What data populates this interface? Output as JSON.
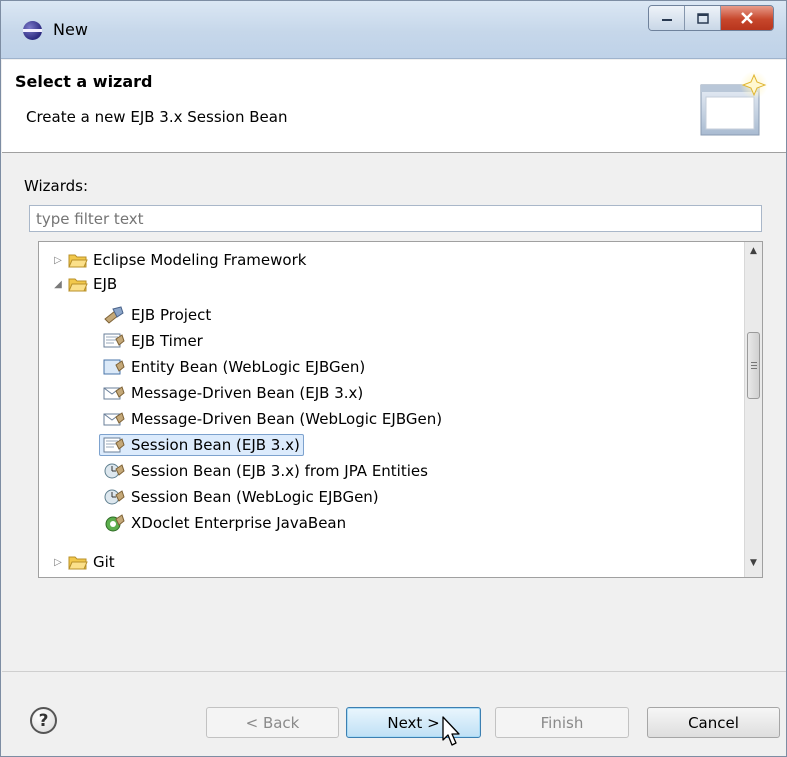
{
  "window": {
    "title": "New"
  },
  "header": {
    "title": "Select a wizard",
    "description": "Create a new EJB 3.x Session Bean"
  },
  "wizards_label": "Wizards:",
  "filter": {
    "value": "",
    "placeholder": "type filter text"
  },
  "tree": {
    "rows": [
      {
        "label": "Eclipse Modeling Framework",
        "type": "folder",
        "expanded": false
      },
      {
        "label": "EJB",
        "type": "folder",
        "expanded": true
      },
      {
        "label": "EJB Project",
        "type": "item",
        "icon": "ejb-project-icon"
      },
      {
        "label": "EJB Timer",
        "type": "item",
        "icon": "ejb-timer-icon"
      },
      {
        "label": "Entity Bean (WebLogic EJBGen)",
        "type": "item",
        "icon": "entity-bean-icon"
      },
      {
        "label": "Message-Driven Bean (EJB 3.x)",
        "type": "item",
        "icon": "message-bean-icon"
      },
      {
        "label": "Message-Driven Bean (WebLogic EJBGen)",
        "type": "item",
        "icon": "message-bean-icon"
      },
      {
        "label": "Session Bean (EJB 3.x)",
        "type": "item",
        "icon": "session-bean-icon",
        "selected": true
      },
      {
        "label": "Session Bean (EJB 3.x) from JPA Entities",
        "type": "item",
        "icon": "session-bean-jpa-icon"
      },
      {
        "label": "Session Bean (WebLogic EJBGen)",
        "type": "item",
        "icon": "session-bean-jpa-icon"
      },
      {
        "label": "XDoclet Enterprise JavaBean",
        "type": "item",
        "icon": "xdoclet-icon"
      },
      {
        "label": "Git",
        "type": "folder",
        "expanded": false
      }
    ]
  },
  "buttons": {
    "help": "?",
    "back": "< Back",
    "next": "Next >",
    "finish": "Finish",
    "cancel": "Cancel"
  },
  "colors": {
    "selection": "#dcebfc",
    "folder": "#f2c84b",
    "close_button": "#c7472c"
  }
}
